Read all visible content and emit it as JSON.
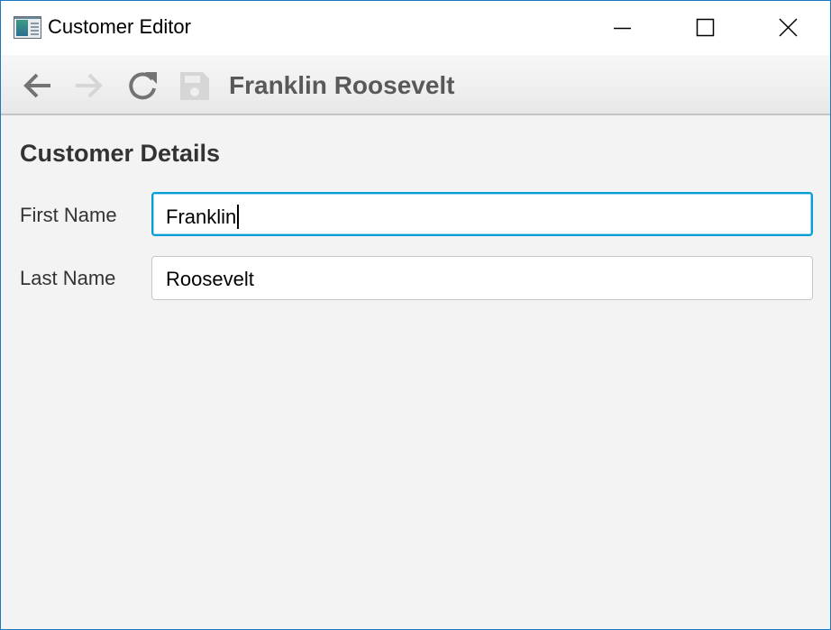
{
  "window": {
    "title": "Customer Editor",
    "controls": {
      "minimize_icon": "minimize-icon",
      "maximize_icon": "maximize-icon",
      "close_icon": "close-icon"
    }
  },
  "toolbar": {
    "buttons": [
      {
        "icon": "arrow-left-icon",
        "enabled": true
      },
      {
        "icon": "arrow-right-icon",
        "enabled": false
      },
      {
        "icon": "reload-icon",
        "enabled": true
      },
      {
        "icon": "save-icon",
        "enabled": false
      }
    ],
    "title": "Franklin Roosevelt"
  },
  "form": {
    "heading": "Customer Details",
    "fields": [
      {
        "label": "First Name",
        "value": "Franklin",
        "focused": true
      },
      {
        "label": "Last Name",
        "value": "Roosevelt",
        "focused": false
      }
    ]
  },
  "colors": {
    "focus_border": "#039ed3",
    "window_border": "#1b79c4",
    "background": "#f3f3f3",
    "toolbar_title": "#595959",
    "icon_enabled": "#737373",
    "icon_disabled": "#d6d6d6"
  }
}
